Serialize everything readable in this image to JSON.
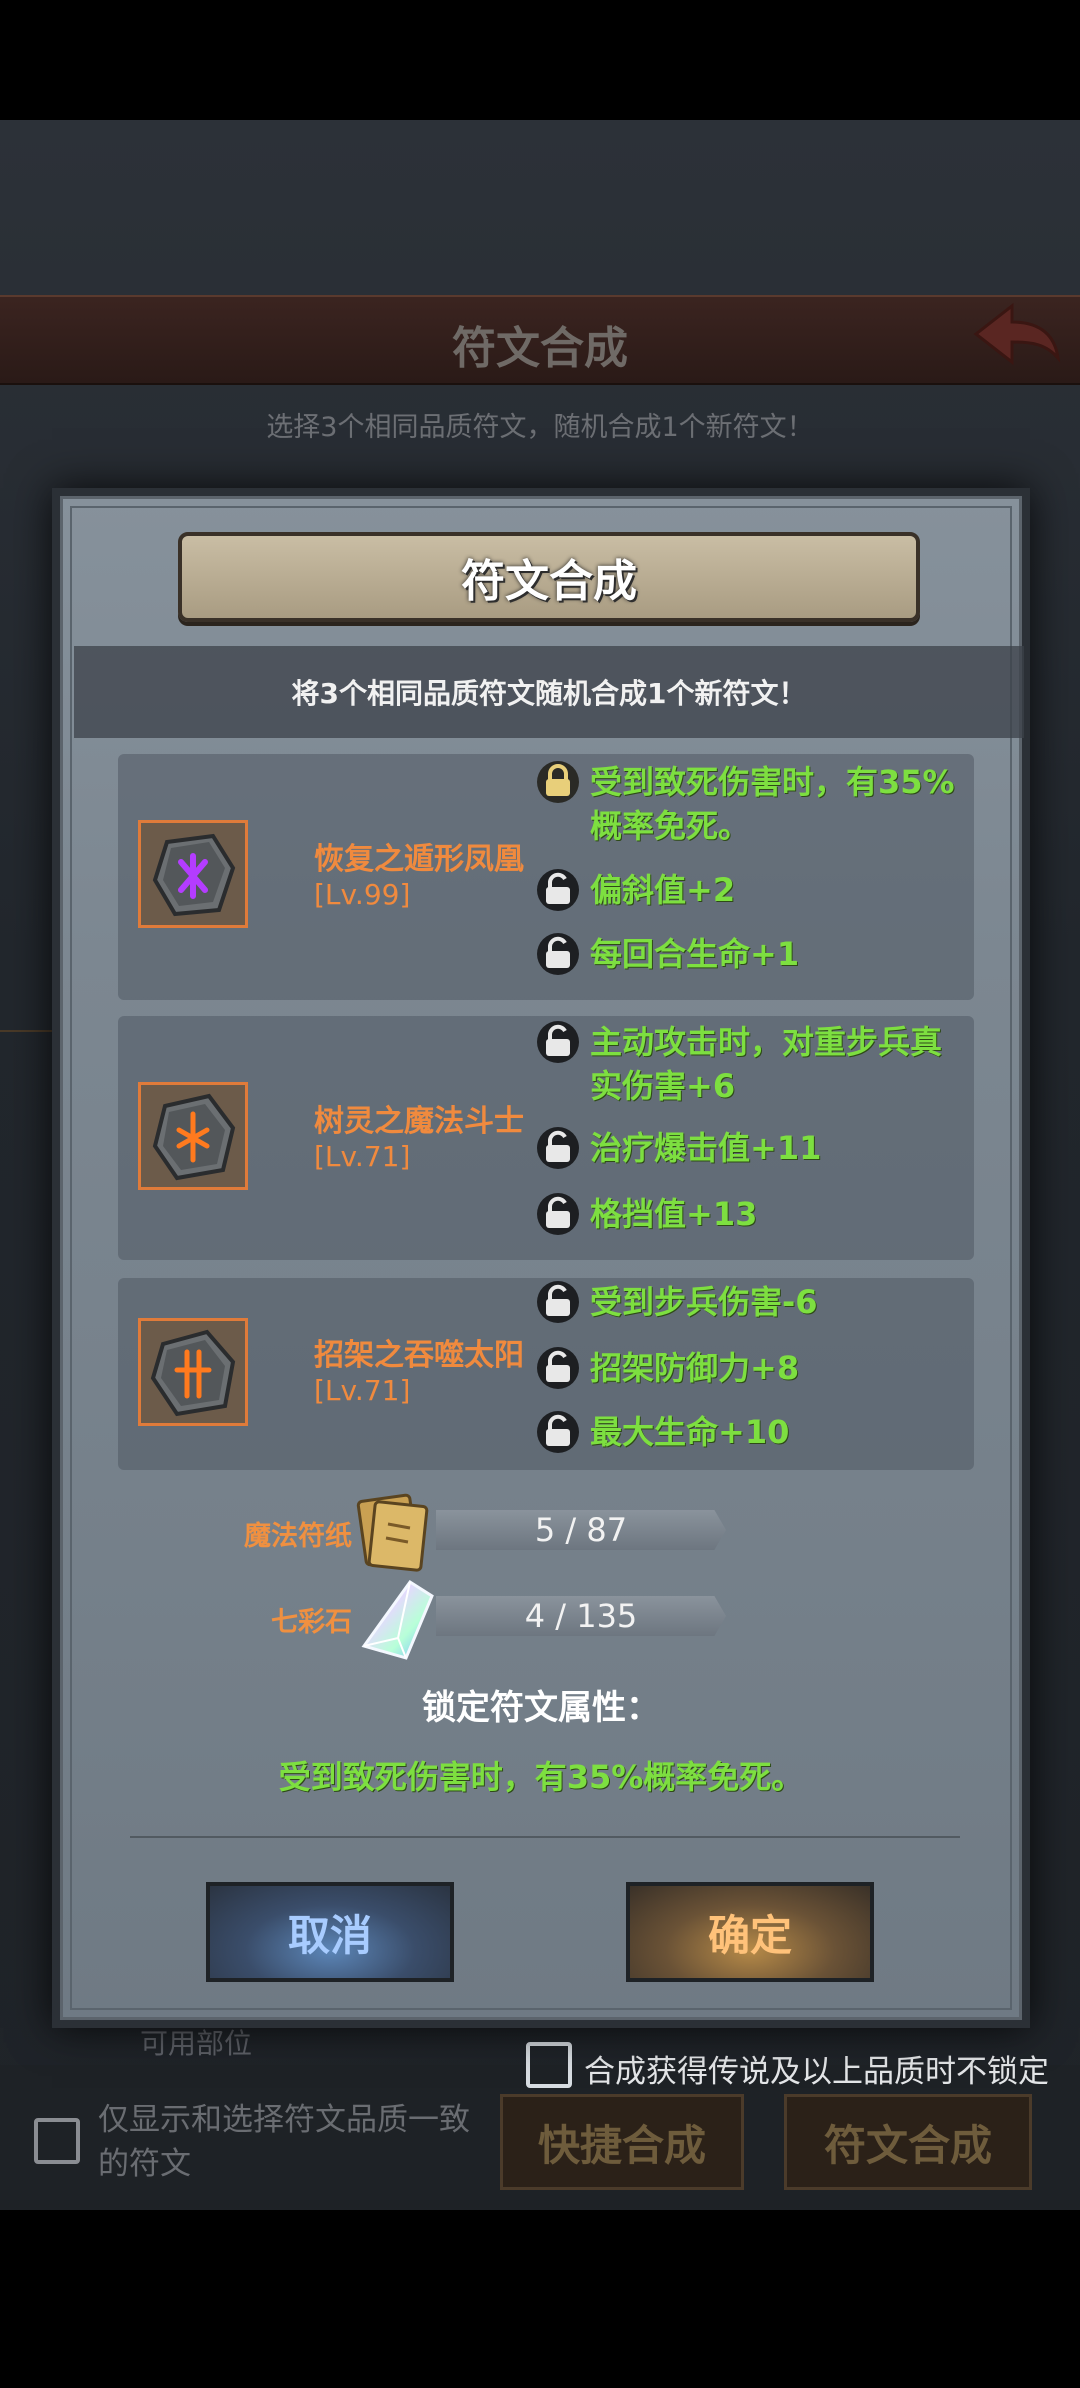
{
  "background": {
    "title": "符文合成",
    "subtitle": "选择3个相同品质符文，随机合成1个新符文！",
    "part_filter": "可用部位",
    "bottom": {
      "no_lock_label": "合成获得传说及以上品质时不锁定",
      "quality_filter_label": "仅显示和选择符文品质一致的符文",
      "quick_button": "快捷合成",
      "compose_button": "符文合成"
    }
  },
  "dialog": {
    "title": "符文合成",
    "description": "将3个相同品质符文随机合成1个新符文！",
    "runes": [
      {
        "name": "恢复之遁形凤凰",
        "level": "[Lv.99]",
        "glyph_color": "#b43cff",
        "attributes": [
          {
            "text": "受到致死伤害时，有35%概率免死。",
            "locked": true
          },
          {
            "text": "偏斜值+2",
            "locked": false
          },
          {
            "text": "每回合生命+1",
            "locked": false
          }
        ]
      },
      {
        "name": "树灵之魔法斗士",
        "level": "[Lv.71]",
        "glyph_color": "#ff7a1e",
        "attributes": [
          {
            "text": "主动攻击时，对重步兵真实伤害+6",
            "locked": false
          },
          {
            "text": "治疗爆击值+11",
            "locked": false
          },
          {
            "text": "格挡值+13",
            "locked": false
          }
        ]
      },
      {
        "name": "招架之吞噬太阳",
        "level": "[Lv.71]",
        "glyph_color": "#ff7a1e",
        "attributes": [
          {
            "text": "受到步兵伤害-6",
            "locked": false
          },
          {
            "text": "招架防御力+8",
            "locked": false
          },
          {
            "text": "最大生命+10",
            "locked": false
          }
        ]
      }
    ],
    "resources": [
      {
        "label": "魔法符纸",
        "amount": "5 / 87",
        "icon": "magic-paper-icon"
      },
      {
        "label": "七彩石",
        "amount": "4 / 135",
        "icon": "rainbow-stone-icon"
      }
    ],
    "lock_title": "锁定符文属性：",
    "lock_value": "受到致死伤害时，有35%概率免死。",
    "cancel_label": "取消",
    "confirm_label": "确定"
  },
  "colors": {
    "attribute_green": "#7ddf40",
    "rune_orange": "#f08a3e",
    "cancel_blue": "#a8ccff",
    "confirm_gold": "#ffc27a"
  }
}
